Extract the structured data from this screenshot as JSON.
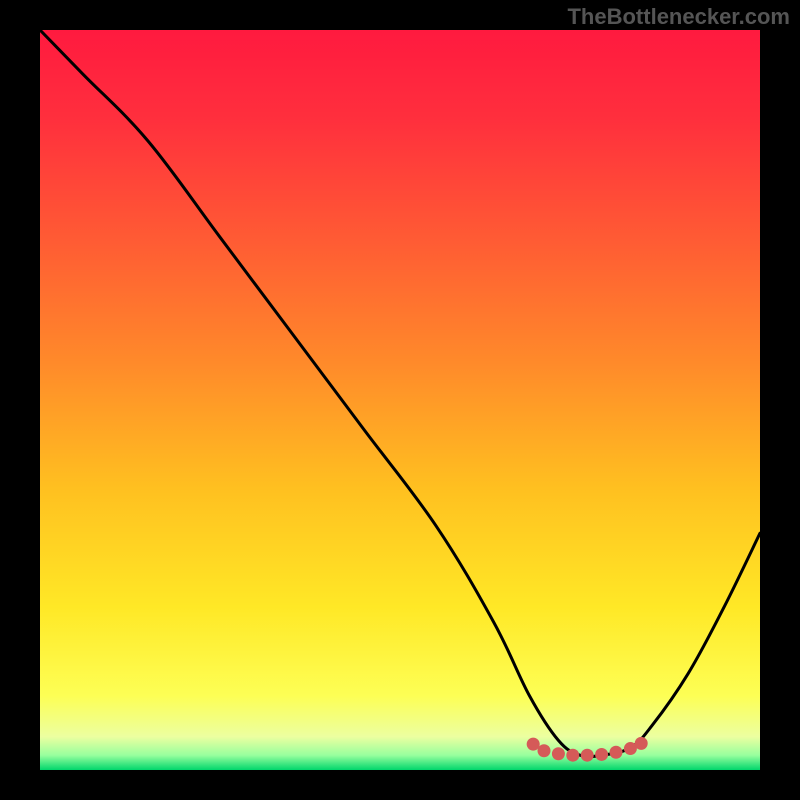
{
  "attribution": "TheBottlenecker.com",
  "gradient_stops": [
    {
      "offset": 0.0,
      "color": "#ff1a3f"
    },
    {
      "offset": 0.12,
      "color": "#ff2f3d"
    },
    {
      "offset": 0.28,
      "color": "#ff5a34"
    },
    {
      "offset": 0.45,
      "color": "#ff8a2a"
    },
    {
      "offset": 0.62,
      "color": "#ffc020"
    },
    {
      "offset": 0.78,
      "color": "#ffe826"
    },
    {
      "offset": 0.9,
      "color": "#fdff55"
    },
    {
      "offset": 0.955,
      "color": "#ecffa0"
    },
    {
      "offset": 0.98,
      "color": "#98ff9e"
    },
    {
      "offset": 1.0,
      "color": "#00d66c"
    }
  ],
  "colors": {
    "curve": "#000000",
    "dots": "#d55a58",
    "background": "#000000"
  },
  "chart_data": {
    "type": "line",
    "title": "",
    "xlabel": "",
    "ylabel": "",
    "xlim": [
      0,
      100
    ],
    "ylim": [
      0,
      100
    ],
    "series": [
      {
        "name": "bottleneck-curve",
        "x": [
          0,
          6,
          15,
          25,
          35,
          45,
          55,
          63,
          68,
          72,
          75,
          78,
          82,
          85,
          90,
          95,
          100
        ],
        "y": [
          100,
          94,
          85,
          72,
          59,
          46,
          33,
          20,
          10,
          4,
          2,
          2,
          3,
          6,
          13,
          22,
          32
        ]
      }
    ],
    "dot_points": {
      "name": "highlight-band",
      "x": [
        68.5,
        70,
        72,
        74,
        76,
        78,
        80,
        82,
        83.5
      ],
      "y": [
        3.5,
        2.6,
        2.2,
        2.0,
        2.0,
        2.1,
        2.4,
        2.9,
        3.6
      ]
    },
    "axes_shown": false,
    "grid": false
  }
}
